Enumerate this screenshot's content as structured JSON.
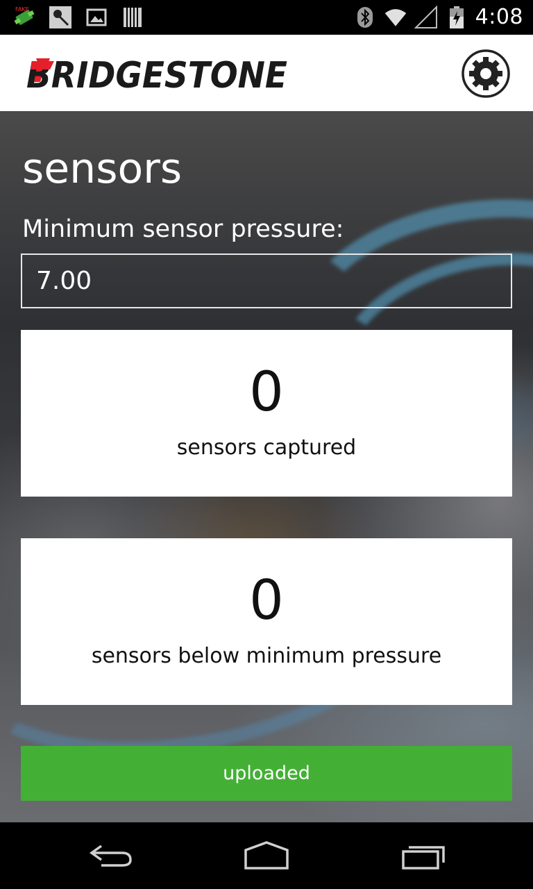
{
  "status_bar": {
    "time": "4:08",
    "left_icons": [
      "fake-gps-icon",
      "microphone-icon",
      "image-icon",
      "barcode-icon"
    ],
    "right_icons": [
      "bluetooth-icon",
      "wifi-icon",
      "signal-icon",
      "battery-charging-icon"
    ]
  },
  "header": {
    "logo": "BRIDGESTONE",
    "settings_icon": "gear-icon"
  },
  "main": {
    "title": "sensors",
    "pressure_label": "Minimum sensor pressure:",
    "pressure_value": "7.00",
    "cards": [
      {
        "count": "0",
        "label": "sensors captured"
      },
      {
        "count": "0",
        "label": "sensors below minimum pressure"
      }
    ],
    "upload_label": "uploaded"
  },
  "nav": {
    "icons": [
      "back-icon",
      "home-icon",
      "recent-apps-icon"
    ]
  },
  "colors": {
    "upload_green": "#43b035",
    "logo_red": "#e4202a",
    "header_bg": "#ffffff"
  }
}
